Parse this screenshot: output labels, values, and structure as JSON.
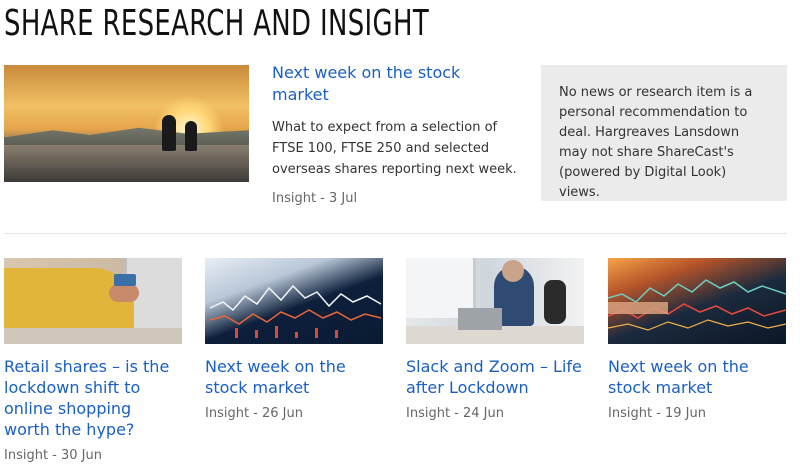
{
  "page": {
    "title": "SHARE RESEARCH AND INSIGHT"
  },
  "featured": {
    "image_icon": "cyclists-sunset-image",
    "title": "Next week on the stock market",
    "description": "What to expect from a selection of FTSE 100, FTSE 250 and selected overseas shares reporting next week.",
    "meta": "Insight - 3 Jul"
  },
  "disclaimer": {
    "text": "No news or research item is a personal recommendation to deal. Hargreaves Lansdown may not share ShareCast's (powered by Digital Look) views."
  },
  "cards": [
    {
      "image_icon": "online-shopping-image",
      "title": "Retail shares – is the lockdown shift to online shopping worth the hype?",
      "meta": "Insight - 30 Jun"
    },
    {
      "image_icon": "stock-chart-tablet-image",
      "title": "Next week on the stock market",
      "meta": "Insight - 26 Jun"
    },
    {
      "image_icon": "home-office-image",
      "title": "Slack and Zoom – Life after Lockdown",
      "meta": "Insight - 24 Jun"
    },
    {
      "image_icon": "stock-chart-screen-image",
      "title": "Next week on the stock market",
      "meta": "Insight - 19 Jun"
    }
  ],
  "colors": {
    "link": "#1a5fc4",
    "meta": "#666666",
    "disclaimer_bg": "#ebebeb"
  }
}
